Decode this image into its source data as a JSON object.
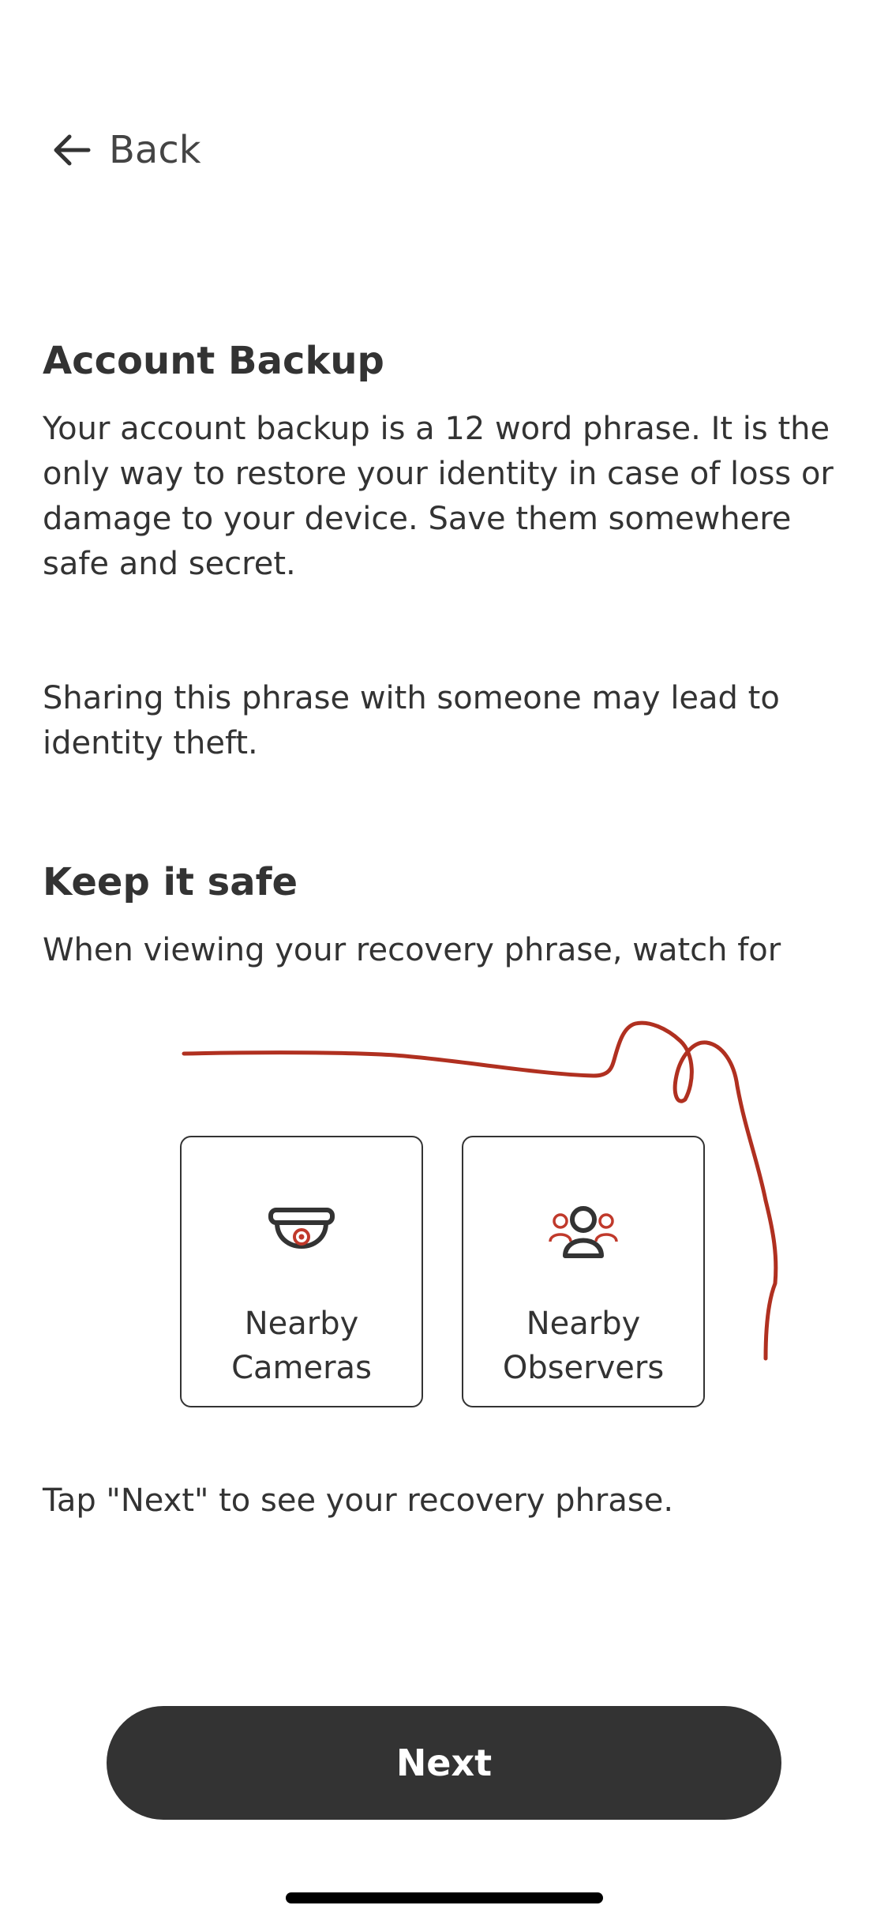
{
  "header": {
    "back_label": "Back",
    "back_icon": "arrow-left-icon"
  },
  "backup": {
    "title": "Account Backup",
    "description": "Your account backup is a 12 word phrase. It is the only way to restore your identity in case of loss or damage to your device. Save them somewhere safe and secret.",
    "warning": "Sharing this phrase with someone may lead to identity theft."
  },
  "safety": {
    "title": "Keep it safe",
    "intro": "When viewing your recovery phrase, watch for",
    "cards": [
      {
        "label": "Nearby\nCameras",
        "icon": "security-camera-icon"
      },
      {
        "label": "Nearby\nObservers",
        "icon": "observers-icon"
      }
    ],
    "instruction": "Tap \"Next\" to see your recovery phrase."
  },
  "footer": {
    "next_label": "Next"
  },
  "colors": {
    "text": "#333333",
    "accent": "#C0392B",
    "annotation": "#B03020",
    "button_bg": "#333333",
    "button_text": "#FFFFFF"
  }
}
